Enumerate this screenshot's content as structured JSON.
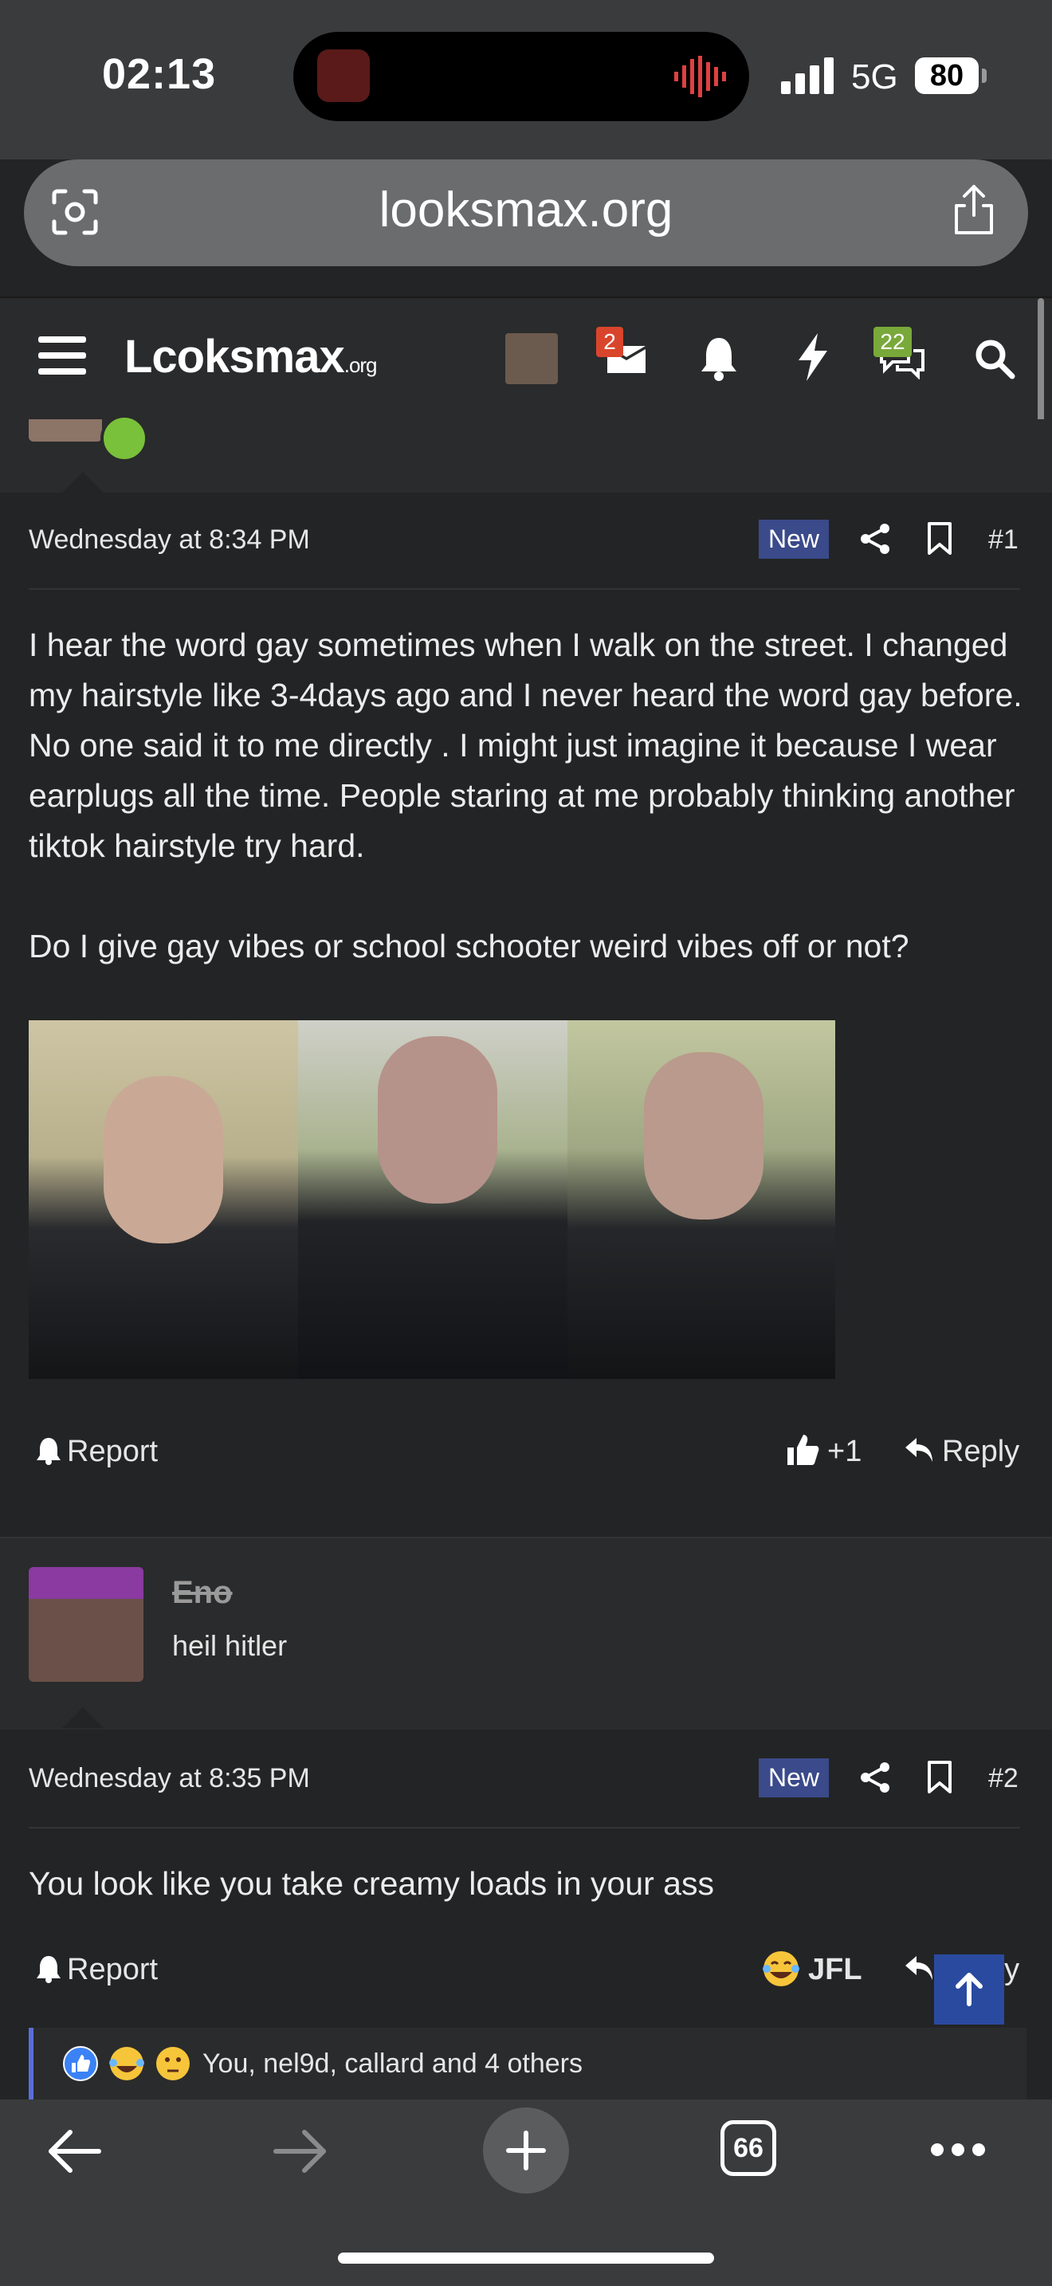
{
  "status_bar": {
    "time": "02:13",
    "network": "5G",
    "battery": "80"
  },
  "browser": {
    "url": "looksmax.org",
    "tab_count": "66"
  },
  "site": {
    "logo": "Lcoksmax",
    "logo_suffix": ".org",
    "badges": {
      "messages": "2",
      "chat": "22"
    }
  },
  "posts": [
    {
      "timestamp": "Wednesday at 8:34 PM",
      "badge": "New",
      "number": "#1",
      "paragraphs": [
        "I hear the word gay sometimes when I walk on the street. I changed my hairstyle like 3-4days ago and I never heard the word gay before. No one said it to me directly . I might just imagine it because I wear earplugs all the time. People staring at me probably thinking another tiktok hairstyle try hard.",
        "Do I give gay vibes or school schooter weird vibes off or not?"
      ],
      "report_label": "Report",
      "reaction": "+1",
      "reply_label": "Reply"
    },
    {
      "username": "Eno",
      "signature": "heil hitler",
      "timestamp": "Wednesday at 8:35 PM",
      "badge": "New",
      "number": "#2",
      "body": "You look like you take creamy loads in your ass",
      "report_label": "Report",
      "reaction": "JFL",
      "reply_label": "Reply",
      "reactions_summary": "You, nel9d, callard and 4 others"
    }
  ],
  "colors": {
    "accent": "#3a4a8a",
    "online": "#79c13a",
    "background": "#232425"
  }
}
